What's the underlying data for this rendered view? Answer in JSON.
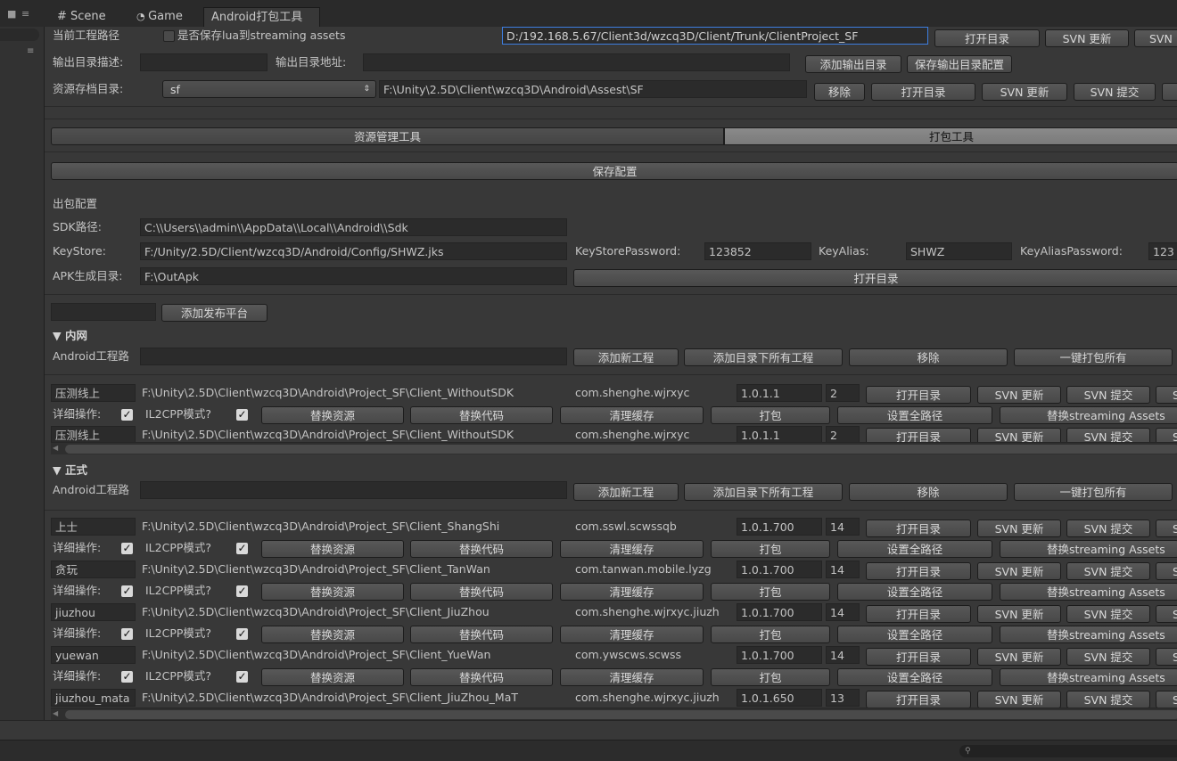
{
  "tabs": [
    "# Scene",
    "Game",
    "Android打包工具"
  ],
  "tab_icons": [
    "grid-icon",
    "pacman-icon"
  ],
  "top": {
    "current_path_label": "当前工程路径",
    "save_lua_label": "是否保存lua到streaming assets",
    "project_path": "D:/192.168.5.67/Client3d/wzcq3D/Client/Trunk/ClientProject_SF",
    "open_dir": "打开目录",
    "svn_update": "SVN 更新",
    "svn_commit": "SVN 提交",
    "svn_partial": "SVN",
    "output_desc_label": "输出目录描述:",
    "output_addr_label": "输出目录地址:",
    "add_output": "添加输出目录",
    "save_output_config": "保存输出目录配置",
    "res_dir_label": "资源存档目录:",
    "res_select": "sf",
    "res_path": "F:\\Unity\\2.5D\\Client\\wzcq3D\\Android\\Assest\\SF",
    "remove": "移除"
  },
  "toolbar_tabs": [
    "资源管理工具",
    "打包工具"
  ],
  "save_config": "保存配置",
  "pack_config": {
    "title": "出包配置",
    "sdk_label": "SDK路径:",
    "sdk_value": "C:\\\\Users\\\\admin\\\\AppData\\\\Local\\\\Android\\\\Sdk",
    "keystore_label": "KeyStore:",
    "keystore_value": "F:/Unity/2.5D/Client/wzcq3D/Android/Config/SHWZ.jks",
    "ks_pwd_label": "KeyStorePassword:",
    "ks_pwd_value": "123852",
    "alias_label": "KeyAlias:",
    "alias_value": "SHWZ",
    "alias_pwd_label": "KeyAliasPassword:",
    "alias_pwd_value": "123",
    "apk_label": "APK生成目录:",
    "apk_value": "F:\\OutApk",
    "open_dir": "打开目录"
  },
  "add_platform": "添加发布平台",
  "row_labels": {
    "detail": "详细操作:",
    "il2cpp": "IL2CPP模式?",
    "replace_res": "替换资源",
    "replace_code": "替换代码",
    "clear_cache": "清理缓存",
    "build": "打包",
    "set_paths": "设置全路径",
    "replace_streaming": "替换streaming Assets",
    "open_dir": "打开目录",
    "svn_update": "SVN 更新",
    "svn_commit": "SVN 提交",
    "s_partial": "S"
  },
  "groups": [
    {
      "title": "▼ 内网",
      "proj_label": "Android工程路",
      "add_project": "添加新工程",
      "add_all": "添加目录下所有工程",
      "remove": "移除",
      "build_all": "一键打包所有",
      "projects": [
        {
          "name": "压测线上",
          "path": "F:\\Unity\\2.5D\\Client\\wzcq3D\\Android\\Project_SF\\Client_WithoutSDK",
          "package": "com.shenghe.wjrxyc",
          "version": "1.0.1.1",
          "code": "2"
        }
      ],
      "trailing": {
        "name": "压测线上",
        "path": "F:\\Unity\\2.5D\\Client\\wzcq3D\\Android\\Project_SF\\Client_WithoutSDK",
        "package": "com.shenghe.wjrxyc",
        "version": "1.0.1.1",
        "code": "2"
      }
    },
    {
      "title": "▼ 正式",
      "proj_label": "Android工程路",
      "add_project": "添加新工程",
      "add_all": "添加目录下所有工程",
      "remove": "移除",
      "build_all": "一键打包所有",
      "projects": [
        {
          "name": "上士",
          "path": "F:\\Unity\\2.5D\\Client\\wzcq3D\\Android\\Project_SF\\Client_ShangShi",
          "package": "com.sswl.scwssqb",
          "version": "1.0.1.700",
          "code": "14"
        },
        {
          "name": "贪玩",
          "path": "F:\\Unity\\2.5D\\Client\\wzcq3D\\Android\\Project_SF\\Client_TanWan",
          "package": "com.tanwan.mobile.lyzg",
          "version": "1.0.1.700",
          "code": "14"
        },
        {
          "name": "jiuzhou",
          "path": "F:\\Unity\\2.5D\\Client\\wzcq3D\\Android\\Project_SF\\Client_JiuZhou",
          "package": "com.shenghe.wjrxyc.jiuzh",
          "version": "1.0.1.700",
          "code": "14"
        },
        {
          "name": "yuewan",
          "path": "F:\\Unity\\2.5D\\Client\\wzcq3D\\Android\\Project_SF\\Client_YueWan",
          "package": "com.ywscws.scwss",
          "version": "1.0.1.700",
          "code": "14"
        }
      ],
      "trailing": {
        "name": "jiuzhou_mata",
        "path": "F:\\Unity\\2.5D\\Client\\wzcq3D\\Android\\Project_SF\\Client_JiuZhou_MaT",
        "package": "com.shenghe.wjrxyc.jiuzh",
        "version": "1.0.1.650",
        "code": "13"
      }
    }
  ]
}
